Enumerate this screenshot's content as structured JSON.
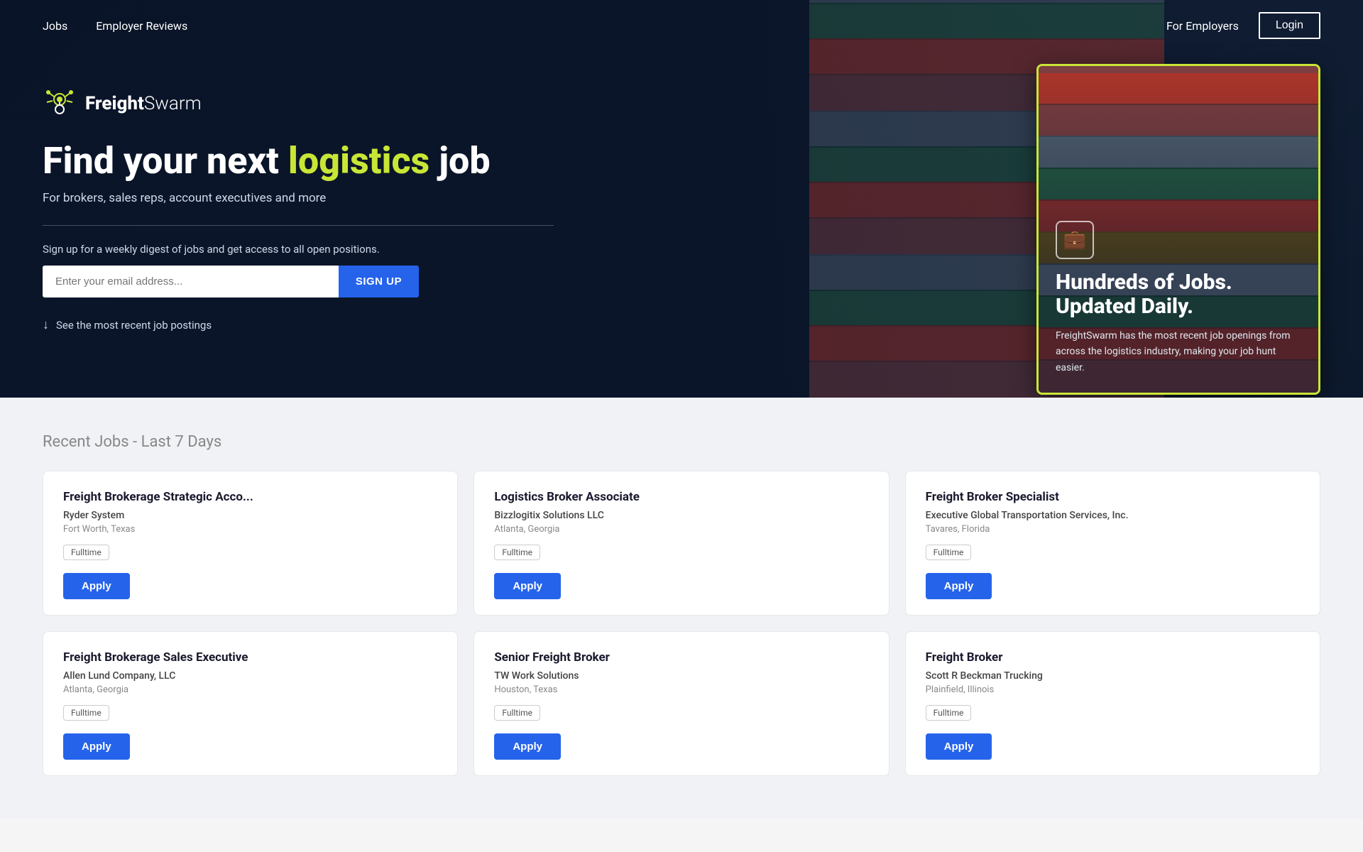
{
  "nav": {
    "jobs_label": "Jobs",
    "employer_reviews_label": "Employer Reviews",
    "for_employers_label": "For Employers",
    "login_label": "Login"
  },
  "hero": {
    "logo_name": "FreightSwarm",
    "logo_bold": "Freight",
    "logo_light": "Swarm",
    "headline_prefix": "Find your next ",
    "headline_highlight": "logistics",
    "headline_suffix": " job",
    "subheading": "For brokers, sales reps, account executives and more",
    "signup_text": "Sign up for a weekly digest of jobs and get access to all open positions.",
    "email_placeholder": "Enter your email address...",
    "signup_btn": "SIGN UP",
    "see_jobs": "See the most recent job postings",
    "card": {
      "headline_line1": "Hundreds of Jobs.",
      "headline_line2": "Updated Daily.",
      "body": "FreightSwarm has the most recent job openings from across the logistics industry, making your job hunt easier."
    }
  },
  "jobs_section": {
    "title": "Recent Jobs - Last 7 Days",
    "jobs": [
      {
        "title": "Freight Brokerage Strategic Acco...",
        "company": "Ryder System",
        "location": "Fort Worth, Texas",
        "type": "Fulltime",
        "apply_label": "Apply"
      },
      {
        "title": "Logistics Broker Associate",
        "company": "Bizzlogitix Solutions LLC",
        "location": "Atlanta, Georgia",
        "type": "Fulltime",
        "apply_label": "Apply"
      },
      {
        "title": "Freight Broker Specialist",
        "company": "Executive Global Transportation Services, Inc.",
        "location": "Tavares, Florida",
        "type": "Fulltime",
        "apply_label": "Apply"
      },
      {
        "title": "Freight Brokerage Sales Executive",
        "company": "Allen Lund Company, LLC",
        "location": "Atlanta, Georgia",
        "type": "Fulltime",
        "apply_label": "Apply"
      },
      {
        "title": "Senior Freight Broker",
        "company": "TW Work Solutions",
        "location": "Houston, Texas",
        "type": "Fulltime",
        "apply_label": "Apply"
      },
      {
        "title": "Freight Broker",
        "company": "Scott R Beckman Trucking",
        "location": "Plainfield, Illinois",
        "type": "Fulltime",
        "apply_label": "Apply"
      }
    ]
  }
}
